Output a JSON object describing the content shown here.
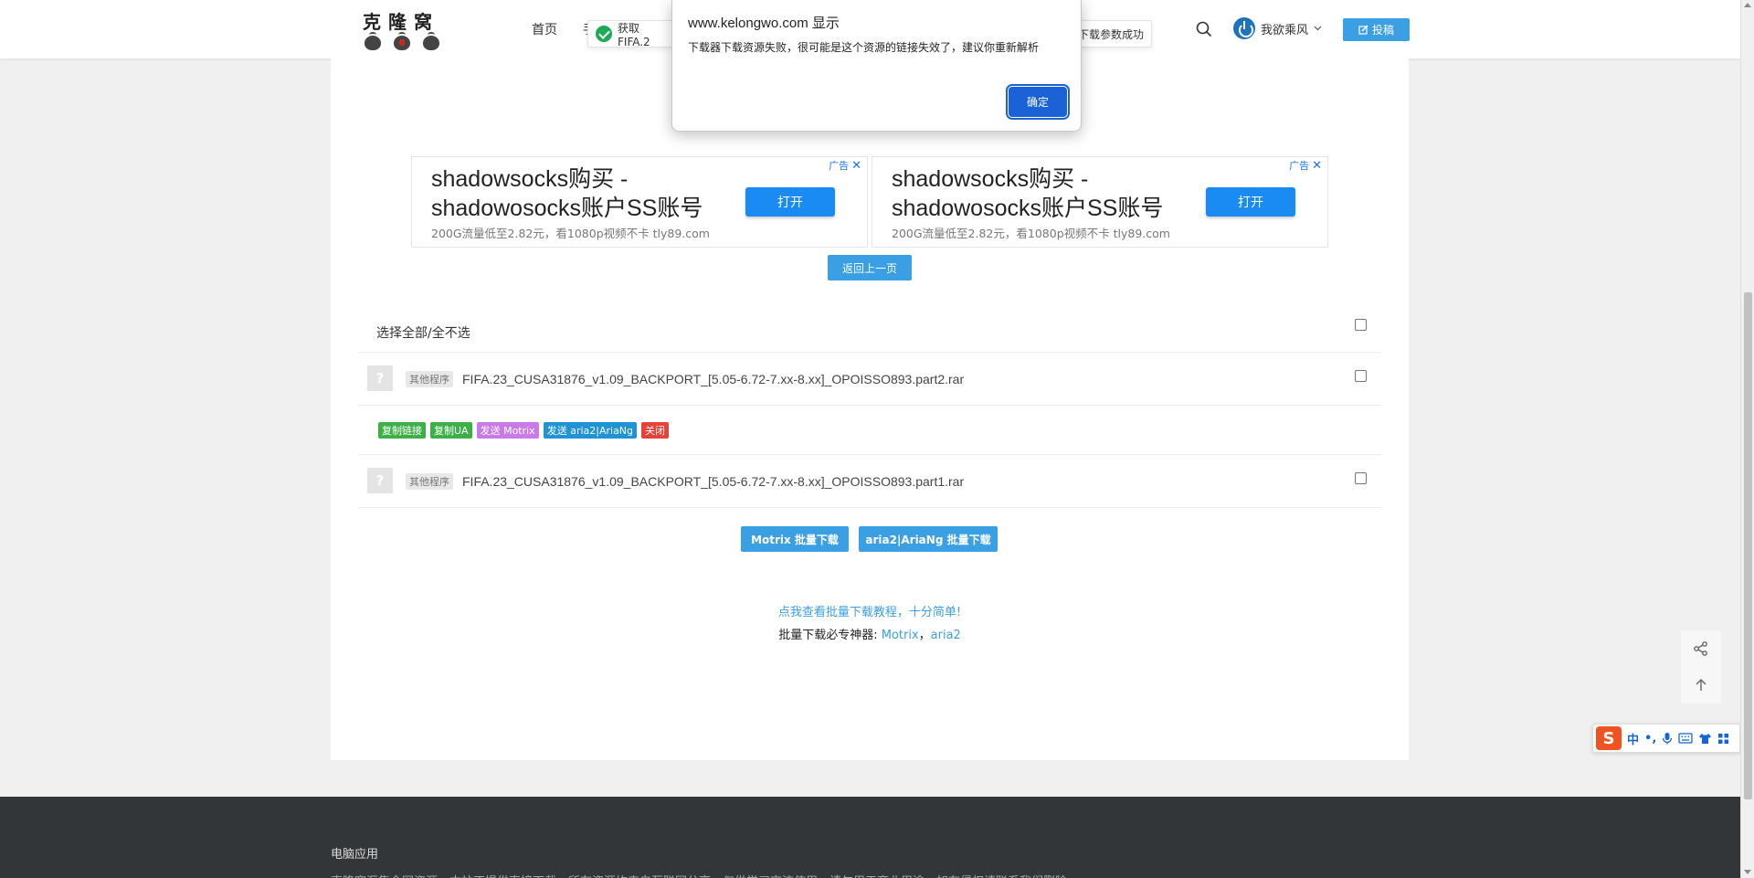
{
  "header": {
    "logo_text": "克隆窝",
    "nav": {
      "home": "首页",
      "more": "手"
    },
    "user_name": "我欲乘风",
    "post_label": "投稿"
  },
  "toasts": {
    "left_text": "获取FIFA.2",
    "right_text": "下载参数成功"
  },
  "dialog": {
    "title": "www.kelongwo.com 显示",
    "message": "下载器下载资源失败，很可能是这个资源的链接失效了，建议你重新解析",
    "ok_label": "确定"
  },
  "ads": [
    {
      "title": "shadowsocks购买 - shadowosocks账户SS账号",
      "desc": "200G流量低至2.82元，看1080p视频不卡 tly89.com",
      "open_label": "打开",
      "tag": "广告"
    },
    {
      "title": "shadowsocks购买 - shadowosocks账户SS账号",
      "desc": "200G流量低至2.82元，看1080p视频不卡 tly89.com",
      "open_label": "打开",
      "tag": "广告"
    }
  ],
  "back_label": "返回上一页",
  "select_all_label": "选择全部/全不选",
  "files": [
    {
      "icon": "?",
      "tag": "其他程序",
      "name": "FIFA.23_CUSA31876_v1.09_BACKPORT_[5.05-6.72-7.xx-8.xx]_OPOISSO893.part2.rar"
    },
    {
      "icon": "?",
      "tag": "其他程序",
      "name": "FIFA.23_CUSA31876_v1.09_BACKPORT_[5.05-6.72-7.xx-8.xx]_OPOISSO893.part1.rar"
    }
  ],
  "actions": {
    "copy_link": "复制链接",
    "copy_ua": "复制UA",
    "send_motrix": "发送 Motrix",
    "send_aria2": "发送 aria2|AriaNg",
    "close": "关闭"
  },
  "batch": {
    "motrix": "Motrix 批量下载",
    "aria2": "aria2|AriaNg 批量下载"
  },
  "tutorial_text": "点我查看批量下载教程，十分简单!",
  "tools": {
    "prefix": "批量下载必专神器: ",
    "motrix": "Motrix",
    "sep": "，",
    "aria2": "aria2"
  },
  "footer": {
    "title": "电脑应用",
    "text": "克隆窝汇集全网资源，本站不提供直接下载，所有资源均来自互联网分享，仅供学习交流使用，请勿用于商业用途。如有侵权请联系我们删除。"
  },
  "ime": {
    "logo": "S",
    "zh": "中",
    "punct": "•,"
  },
  "colors": {
    "accent": "#3a9fe3",
    "ad_button": "#1a8bf2",
    "dialog_button": "#1a62d6",
    "success": "#1eaa57",
    "tag_green": "#3cb046",
    "tag_purple": "#c87be8",
    "tag_blue": "#1e93d8",
    "tag_red": "#e9403a",
    "footer_bg": "#333639"
  },
  "icons": [
    "search-icon",
    "power-icon",
    "chevron-down-icon",
    "edit-icon",
    "check-circle-icon",
    "close-icon",
    "share-icon",
    "arrow-up-icon",
    "microphone-icon",
    "keyboard-icon",
    "shirt-icon",
    "grid-icon"
  ]
}
